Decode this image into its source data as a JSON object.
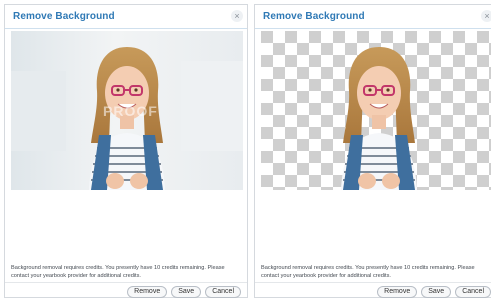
{
  "dialogs": {
    "left": {
      "title": "Remove Background",
      "close_label": "×",
      "watermark": "PROOF",
      "info_text": "Background removal requires credits. You presently have 10 credits remaining. Please contact your yearbook provider for additional credits.",
      "buttons": {
        "remove": "Remove",
        "save": "Save",
        "cancel": "Cancel"
      }
    },
    "right": {
      "title": "Remove Background",
      "close_label": "×",
      "info_text": "Background removal requires credits. You presently have 10 credits remaining. Please contact your yearbook provider for additional credits.",
      "buttons": {
        "remove": "Remove",
        "save": "Save",
        "cancel": "Cancel"
      }
    }
  },
  "colors": {
    "title": "#2f79b5",
    "checker_light": "#ffffff",
    "checker_dark": "#cfcfcf"
  },
  "icons": {
    "close": "close-icon"
  }
}
